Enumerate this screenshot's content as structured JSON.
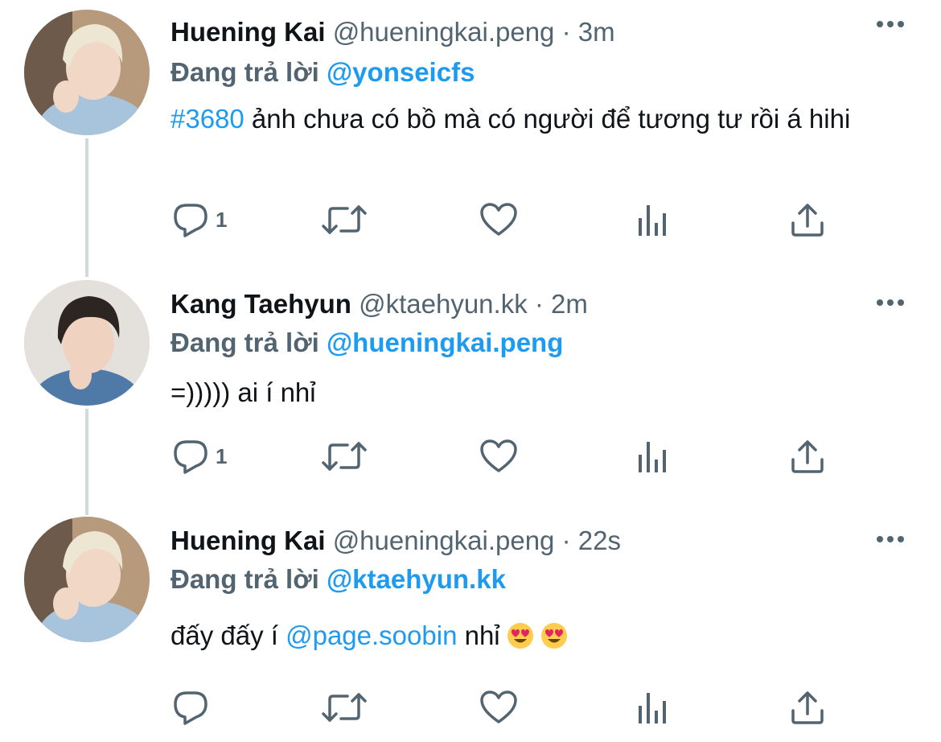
{
  "colors": {
    "accent": "#1d9bf0",
    "secondary": "#536471",
    "text": "#0f1419",
    "thread_line": "#cfd9de"
  },
  "tweets": [
    {
      "name": "Huening Kai",
      "handle": "@hueningkai.peng",
      "dot": "·",
      "time": "3m",
      "replying_prefix": "Đang trả lời",
      "replying_to": "@yonseicfs",
      "hashtag": "#3680",
      "text": " ảnh chưa có bồ mà có người để tương tư rồi á hihi",
      "reply_count": "1",
      "avatar": "blonde-person-avatar"
    },
    {
      "name": "Kang Taehyun",
      "handle": "@ktaehyun.kk",
      "dot": "·",
      "time": "2m",
      "replying_prefix": "Đang trả lời",
      "replying_to": "@hueningkai.peng",
      "text": "=))))) ai í nhỉ",
      "reply_count": "1",
      "avatar": "dark-hair-person-avatar"
    },
    {
      "name": "Huening Kai",
      "handle": "@hueningkai.peng",
      "dot": "·",
      "time": "22s",
      "replying_prefix": "Đang trả lời",
      "replying_to": "@ktaehyun.kk",
      "text_before": "đấy đấy í ",
      "mention": "@page.soobin",
      "text_after": " nhỉ",
      "emojis": [
        "heart-eyes-emoji",
        "heart-eyes-emoji"
      ],
      "reply_count": "",
      "avatar": "blonde-person-avatar"
    }
  ],
  "icons": [
    "reply-icon",
    "retweet-icon",
    "like-icon",
    "views-icon",
    "share-icon",
    "more-icon"
  ]
}
